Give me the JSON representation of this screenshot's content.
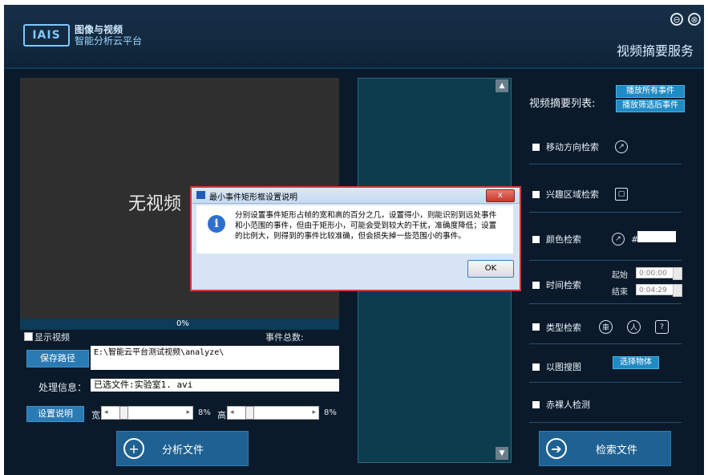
{
  "header": {
    "logo_mark": "IAIS",
    "logo_line1": "图像与视频",
    "logo_line2": "智能分析云平台",
    "service_title": "视频摘要服务",
    "minimize_icon": "⊖",
    "close_icon": "⊗"
  },
  "video": {
    "placeholder": "无视频",
    "progress_text": "0%",
    "progress_fraction": 0,
    "show_video_label": "显示视频",
    "event_total_label": "事件总数:"
  },
  "paths": {
    "save_path_button": "保存路径",
    "save_path_value": "E:\\智能云平台测试视频\\analyze\\",
    "process_label": "处理信息：",
    "process_value": "已选文件:实验室1. avi"
  },
  "settings": {
    "setting_button": "设置说明",
    "width_label": "宽",
    "width_value": "8%",
    "height_label": "高",
    "height_value": "8%"
  },
  "buttons": {
    "analyze": "分析文件",
    "search": "检索文件"
  },
  "right_panel": {
    "list_title": "视频摘要列表:",
    "play_all": "播放所有事件",
    "play_filtered": "播放筛选后事件",
    "move_direction": "移动方向检索",
    "region_interest": "兴趣区域检索",
    "color_search": "颜色检索",
    "color_hash": "#",
    "time_search": "时间检索",
    "start_label": "起始",
    "start_time": "0:00:00",
    "end_label": "结束",
    "end_time": "0:04:29",
    "type_search": "类型检索",
    "type_icon1": "車",
    "type_icon2": "人",
    "type_icon3": "?",
    "image_search": "以图搜图",
    "select_object": "选择物体",
    "nude_detection": "赤裸人检测"
  },
  "dialog": {
    "title": "最小事件矩形框设置说明",
    "close_label": "x",
    "info_glyph": "i",
    "message": "分别设置事件矩形占帧的宽和高的百分之几，设置得小，则能识别到远处事件和小范围的事件，但由于矩形小，可能会受到较大的干扰，准确度降低；设置的比例大，则得到的事件比较准确，但会损失掉一些范围小的事件。",
    "ok": "OK"
  },
  "colors": {
    "accent": "#1f8ac4",
    "background": "#0b1a2a",
    "dialog_border": "#d43a3a"
  }
}
